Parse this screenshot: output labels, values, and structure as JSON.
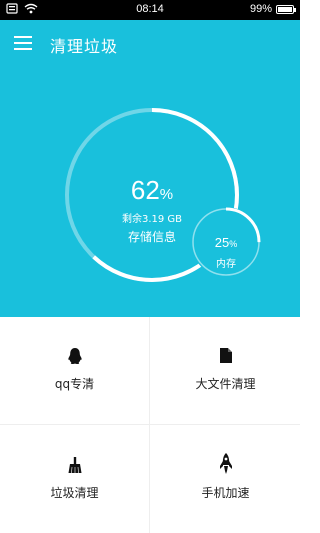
{
  "status_bar": {
    "time": "08:14",
    "battery": "99%",
    "battery_level": 0.99,
    "icons": [
      "notification-icon",
      "wifi-icon",
      "battery-icon"
    ]
  },
  "header": {
    "title": "清理垃圾",
    "menu_icon": "menu-icon"
  },
  "storage": {
    "percent": "62",
    "percent_unit": "%",
    "used_fraction": 0.62,
    "remaining": "剩余3.19 GB",
    "label": "存储信息"
  },
  "memory": {
    "percent": "25",
    "percent_unit": "%",
    "used_fraction": 0.25,
    "label": "内存"
  },
  "tiles": [
    {
      "label": "qq专清",
      "icon": "qq-penguin-icon"
    },
    {
      "label": "大文件清理",
      "icon": "file-icon"
    },
    {
      "label": "垃圾清理",
      "icon": "broom-icon"
    },
    {
      "label": "手机加速",
      "icon": "rocket-icon"
    }
  ],
  "colors": {
    "accent": "#19c0dc",
    "status_bar": "#000000",
    "ring_track": "#6fd6e8",
    "ring_fill": "#ffffff"
  }
}
